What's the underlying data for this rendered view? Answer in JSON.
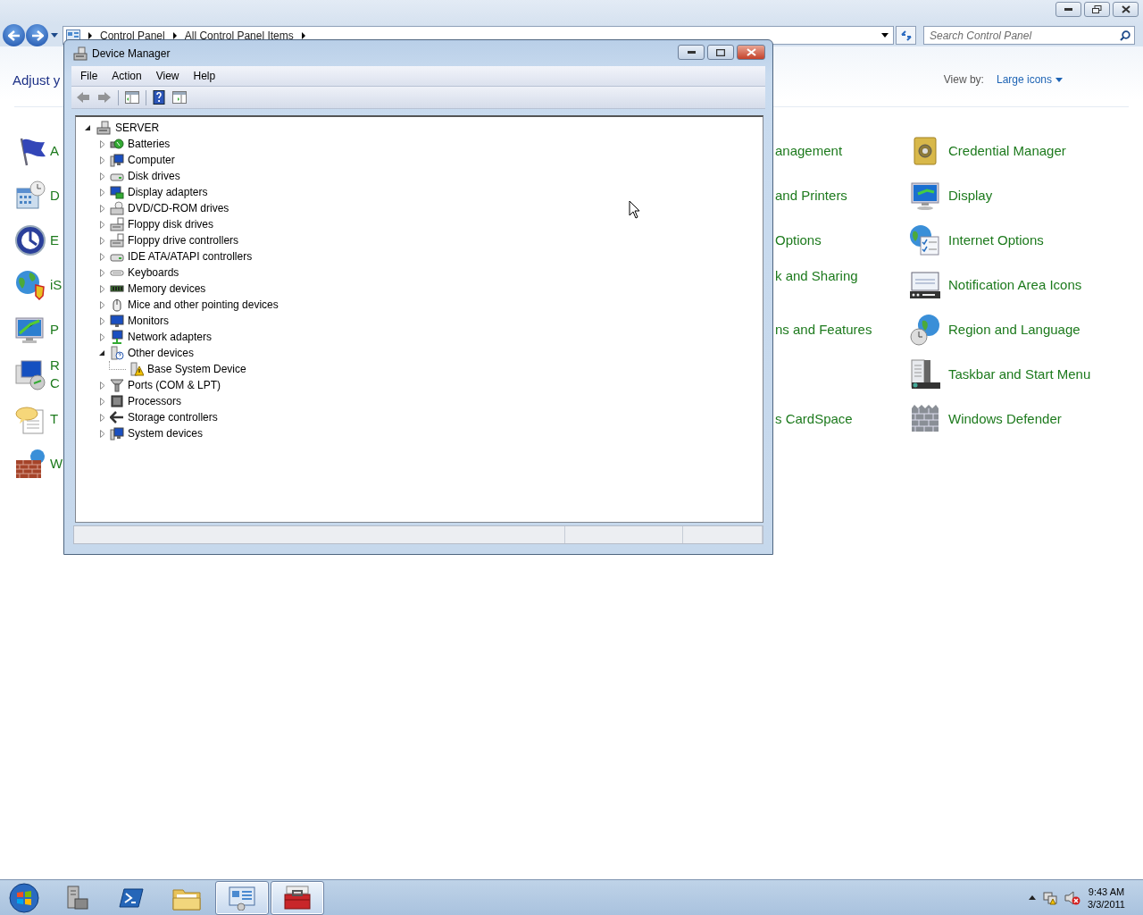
{
  "explorer": {
    "breadcrumbs": [
      "Control Panel",
      "All Control Panel Items"
    ],
    "search": {
      "placeholder": "Search Control Panel"
    },
    "heading": "Adjust y",
    "view_by": {
      "label": "View by:",
      "value": "Large icons"
    },
    "rows": [
      {
        "left": "A",
        "middle": "anagement",
        "right": "Credential Manager"
      },
      {
        "left": "D",
        "middle": "and Printers",
        "right": "Display"
      },
      {
        "left": "E",
        "middle": "Options",
        "right": "Internet Options"
      },
      {
        "left": "iS",
        "middle": "k and Sharing",
        "right": "Notification Area Icons"
      },
      {
        "left": "P",
        "middle": "ns and Features",
        "right": "Region and Language"
      },
      {
        "left": "R\nC",
        "right": "Taskbar and Start Menu"
      },
      {
        "left": "T",
        "middle": "s CardSpace",
        "right": "Windows Defender"
      },
      {
        "left": "W"
      }
    ]
  },
  "device_manager": {
    "title": "Device Manager",
    "menu": [
      "File",
      "Action",
      "View",
      "Help"
    ],
    "toolbar": [
      {
        "disabled": true
      },
      {
        "disabled": true
      },
      {
        "disabled": false
      },
      {
        "disabled": false
      },
      {
        "disabled": false
      }
    ],
    "tree": {
      "label": "SERVER",
      "expanded": true,
      "children": [
        {
          "label": "Batteries",
          "expanded": false
        },
        {
          "label": "Computer",
          "expanded": false
        },
        {
          "label": "Disk drives",
          "expanded": false
        },
        {
          "label": "Display adapters",
          "expanded": false
        },
        {
          "label": "DVD/CD-ROM drives",
          "expanded": false
        },
        {
          "label": "Floppy disk drives",
          "expanded": false
        },
        {
          "label": "Floppy drive controllers",
          "expanded": false
        },
        {
          "label": "IDE ATA/ATAPI controllers",
          "expanded": false
        },
        {
          "label": "Keyboards",
          "expanded": false
        },
        {
          "label": "Memory devices",
          "expanded": false
        },
        {
          "label": "Mice and other pointing devices",
          "expanded": false
        },
        {
          "label": "Monitors",
          "expanded": false
        },
        {
          "label": "Network adapters",
          "expanded": false
        },
        {
          "label": "Other devices",
          "expanded": true,
          "children": [
            {
              "label": "Base System Device",
              "warning": true
            }
          ]
        },
        {
          "label": "Ports (COM & LPT)",
          "expanded": false
        },
        {
          "label": "Processors",
          "expanded": false
        },
        {
          "label": "Storage controllers",
          "expanded": false
        },
        {
          "label": "System devices",
          "expanded": false
        }
      ]
    }
  },
  "taskbar": {
    "apps": [
      {
        "running": false
      },
      {
        "running": false
      },
      {
        "running": false
      },
      {
        "running": true
      },
      {
        "running": true
      }
    ],
    "time": "9:43 AM",
    "date": "3/3/2011"
  }
}
